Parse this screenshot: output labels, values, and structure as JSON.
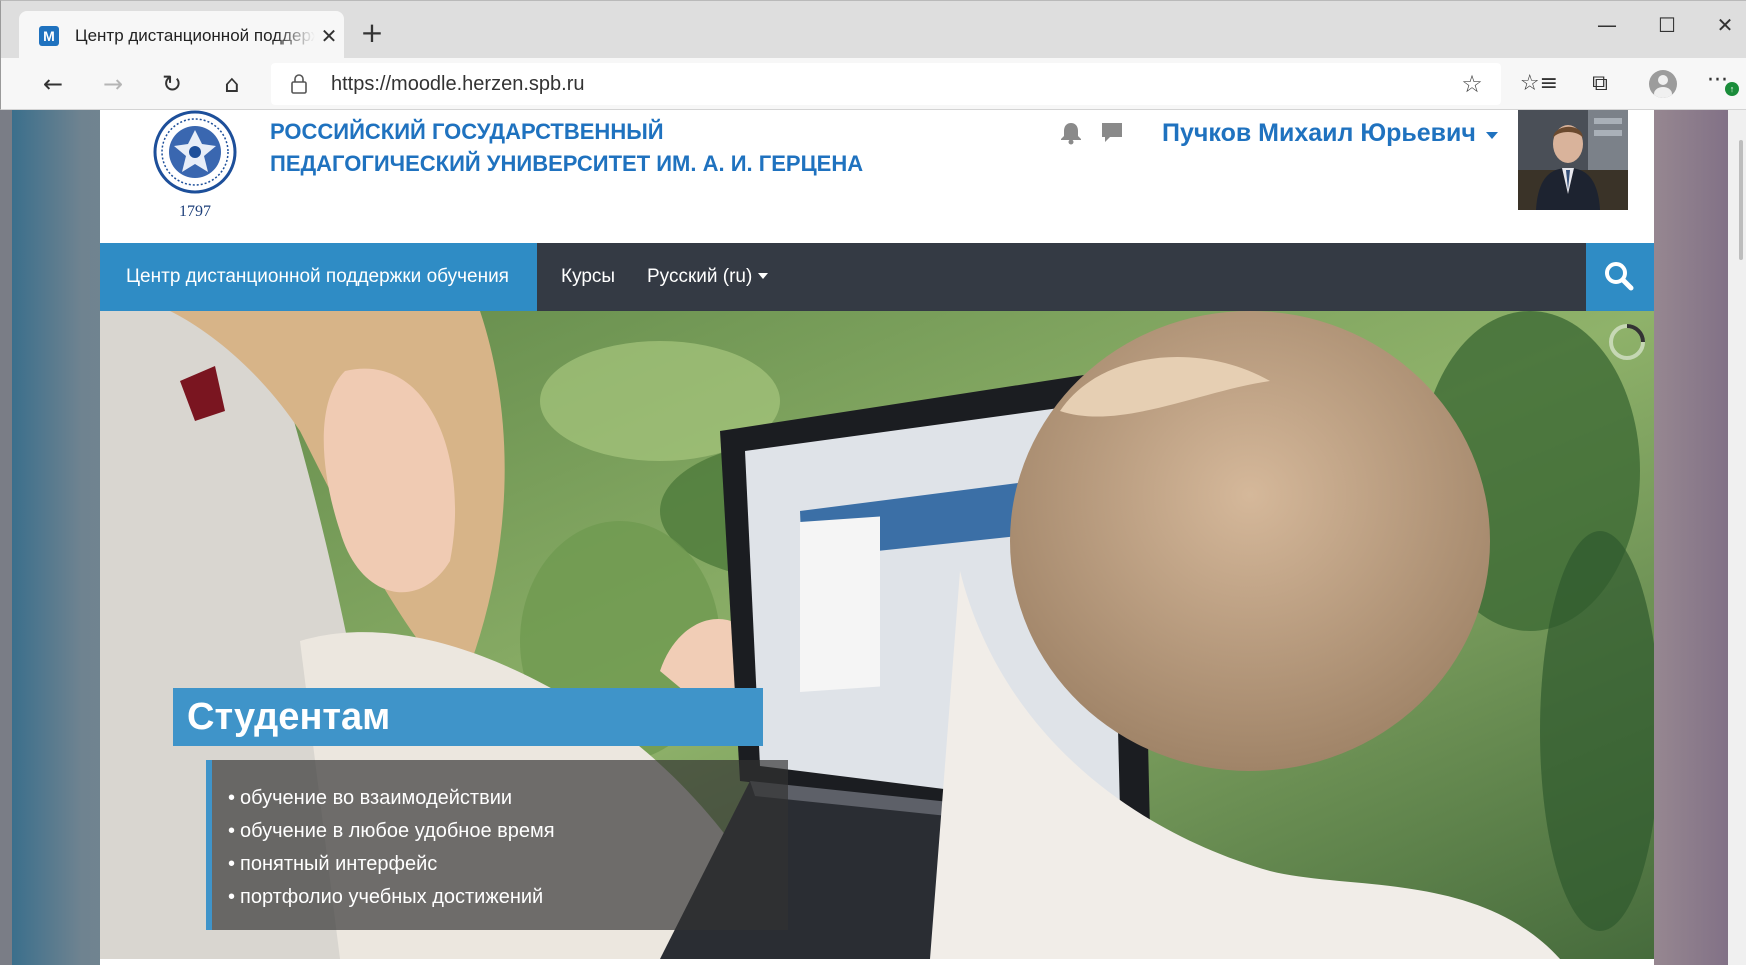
{
  "browser": {
    "tab": {
      "favicon_letter": "M",
      "title": "Центр дистанционной поддержки обучения",
      "close_glyph": "✕"
    },
    "new_tab_glyph": "+",
    "window_controls": {
      "minimize": "—",
      "maximize": "☐",
      "close": "✕"
    },
    "nav": {
      "back": "←",
      "forward": "→",
      "reload": "↻",
      "home": "⌂"
    },
    "address_bar": {
      "url": "https://moodle.herzen.spb.ru",
      "favorite_glyph": "☆"
    },
    "toolbar_icons": {
      "favorites": "☆≡",
      "collections": "⧉",
      "more": "···",
      "badge": "↑"
    }
  },
  "site": {
    "university_name_line1": "РОССИЙСКИЙ ГОСУДАРСТВЕННЫЙ",
    "university_name_line2": "ПЕДАГОГИЧЕСКИЙ УНИВЕРСИТЕТ ИМ. А. И. ГЕРЦЕНА",
    "logo_year": "1797",
    "user_name": "Пучков Михаил Юрьевич",
    "nav": {
      "home": "Центр дистанционной поддержки обучения",
      "courses": "Курсы",
      "language": "Русский (ru)"
    },
    "hero": {
      "title": "Студентам",
      "bullets": [
        "обучение во взаимодействии",
        "обучение в любое удобное время",
        "понятный интерфейс",
        "портфолио учебных достижений"
      ]
    }
  },
  "colors": {
    "accent": "#1f72bf",
    "nav_bg": "#343a44",
    "nav_active": "#2f8cc5",
    "caption_blue": "#3f94c9"
  },
  "icons": {
    "bell": "bell-icon",
    "messages": "chat-icon",
    "search": "search-icon",
    "lock": "lock-icon"
  }
}
